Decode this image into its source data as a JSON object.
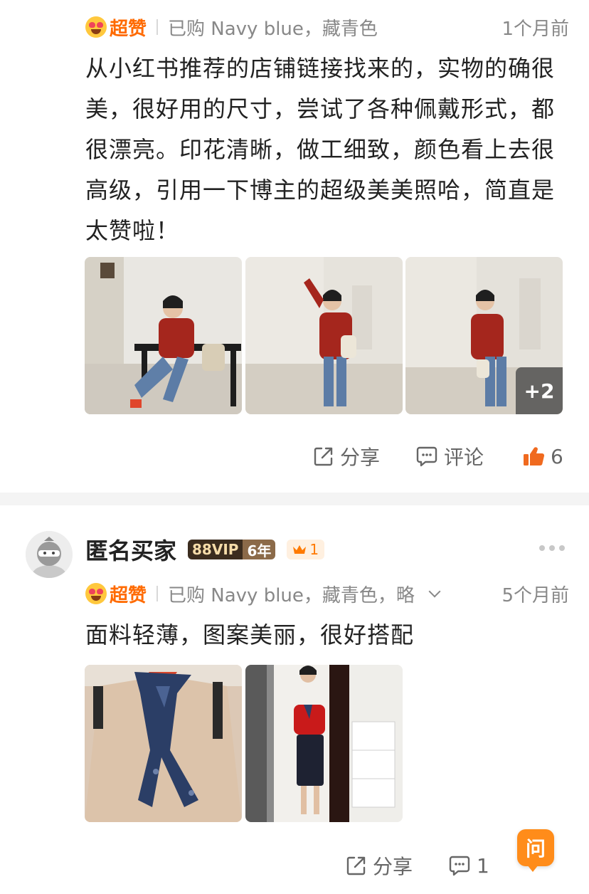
{
  "review1": {
    "rating_label": "超赞",
    "purchase": "已购 Navy blue，藏青色",
    "time": "1个月前",
    "text": "从小红书推荐的店铺链接找来的，实物的确很美，很好用的尺寸，尝试了各种佩戴形式，都很漂亮。印花清晰，做工细致，颜色看上去很高级，引用一下博主的超级美美照哈，简直是太赞啦！",
    "more_photos": "+2",
    "actions": {
      "share": "分享",
      "comment": "评论",
      "like_count": "6"
    }
  },
  "review2": {
    "username": "匿名买家",
    "vip": "88VIP",
    "years": "6年",
    "level": "1",
    "rating_label": "超赞",
    "purchase": "已购 Navy blue，藏青色，略",
    "time": "5个月前",
    "text": "面料轻薄，图案美丽，很好搭配",
    "actions": {
      "share": "分享",
      "comment_count": "1"
    }
  },
  "ask_button": "问",
  "colors": {
    "accent": "#ff6a00",
    "ask": "#ff8c1a",
    "vip_dark": "#3b2c1e"
  },
  "icons": [
    "smiling-heart-eyes-icon",
    "share-icon",
    "comment-icon",
    "thumbs-up-icon",
    "crown-icon",
    "more-icon",
    "chevron-down-icon"
  ]
}
